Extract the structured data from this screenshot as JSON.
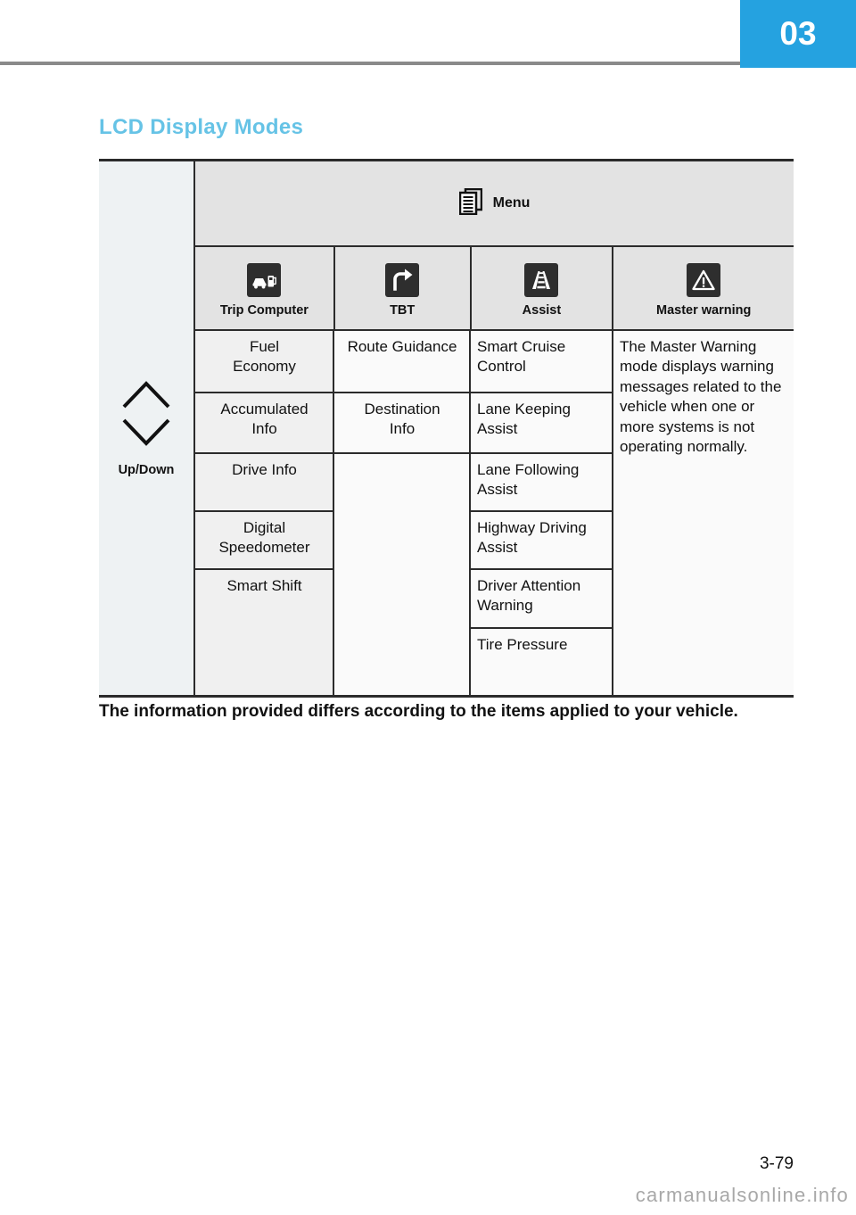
{
  "header": {
    "chapter_number": "03"
  },
  "section": {
    "title": "LCD Display Modes"
  },
  "table": {
    "menu_band": {
      "icon": "menu-documents-icon",
      "label": "Menu"
    },
    "updown_column": {
      "up_icon": "chevron-up-icon",
      "down_icon": "chevron-down-icon",
      "label": "Up/Down"
    },
    "columns": [
      {
        "icon": "car-fuel-pump-icon",
        "label": "Trip Computer"
      },
      {
        "icon": "turn-right-arrow-icon",
        "label": "TBT"
      },
      {
        "icon": "lane-road-icon",
        "label": "Assist"
      },
      {
        "icon": "warning-triangle-icon",
        "label": "Master warning"
      }
    ],
    "trip_computer_items": [
      "Fuel\nEconomy",
      "Accumulated\nInfo",
      "Drive Info",
      "Digital\nSpeedometer",
      "Smart Shift"
    ],
    "tbt_items": [
      "Route Guidance",
      "Destination\nInfo"
    ],
    "assist_items": [
      "Smart Cruise Control",
      "Lane Keeping Assist",
      "Lane Following Assist",
      "Highway Driving Assist",
      "Driver Attention Warning",
      "Tire Pressure"
    ],
    "master_warning_text": "The Master Warning mode displays warning messages related to the vehicle when one or more systems is not operating normally."
  },
  "note": "The information provided differs according to the items applied to your vehicle.",
  "footer": {
    "page_number": "3-79",
    "watermark": "carmanualsonline.info"
  },
  "colors": {
    "accent_blue": "#25a2e0",
    "title_blue": "#66c3e6",
    "header_band": "#e3e3e3",
    "tint_row": "#f0f0f0",
    "rule_gray": "#8a8a8a"
  }
}
